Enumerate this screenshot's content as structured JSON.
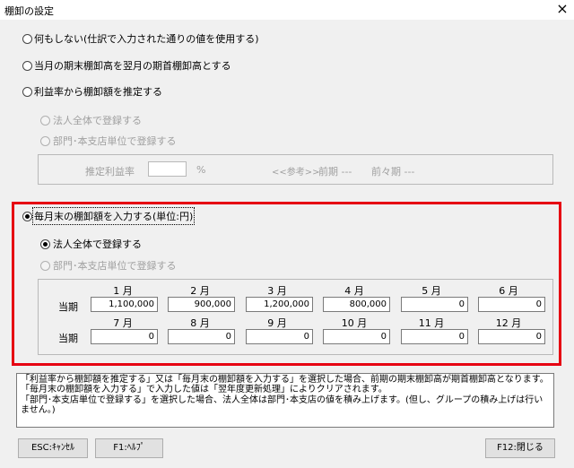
{
  "window": {
    "title": "棚卸の設定",
    "close": "×"
  },
  "options": {
    "opt1": "何もしない(仕訳で入力された通りの値を使用する)",
    "opt2": "当月の期末棚卸高を翌月の期首棚卸高とする",
    "opt3": "利益率から棚卸額を推定する",
    "sub_all": "法人全体で登録する",
    "sub_dept": "部門･本支店単位で登録する",
    "est_label": "推定利益率",
    "est_value": "",
    "est_unit": "%",
    "ref_label": "<<参考>>",
    "prev_period": "前期 ---",
    "prev_prev_period": "前々期 ---",
    "opt4": "毎月末の棚卸額を入力する(単位:円)",
    "sub4_all": "法人全体で登録する",
    "sub4_dept": "部門･本支店単位で登録する"
  },
  "grid": {
    "row_label": "当期",
    "row1": [
      {
        "month": "1 月",
        "value": "1,100,000"
      },
      {
        "month": "2 月",
        "value": "900,000"
      },
      {
        "month": "3 月",
        "value": "1,200,000"
      },
      {
        "month": "4 月",
        "value": "800,000"
      },
      {
        "month": "5 月",
        "value": "0"
      },
      {
        "month": "6 月",
        "value": "0"
      }
    ],
    "row2": [
      {
        "month": "7 月",
        "value": "0"
      },
      {
        "month": "8 月",
        "value": "0"
      },
      {
        "month": "9 月",
        "value": "0"
      },
      {
        "month": "10 月",
        "value": "0"
      },
      {
        "month": "11 月",
        "value": "0"
      },
      {
        "month": "12 月",
        "value": "0"
      }
    ]
  },
  "note": {
    "line1": "「利益率から棚卸額を推定する」又は「毎月末の棚卸額を入力する」を選択した場合、前期の期末棚卸高が期首棚卸高となります。",
    "line2": "「毎月末の棚卸額を入力する」で入力した値は「翌年度更新処理」によりクリアされます。",
    "line3": "「部門･本支店単位で登録する」を選択した場合、法人全体は部門･本支店の値を積み上げます。(但し、グループの積み上げは行いません。)"
  },
  "buttons": {
    "cancel": "ESC:ｷｬﾝｾﾙ",
    "help": "F1:ﾍﾙﾌﾟ",
    "close": "F12:閉じる"
  }
}
